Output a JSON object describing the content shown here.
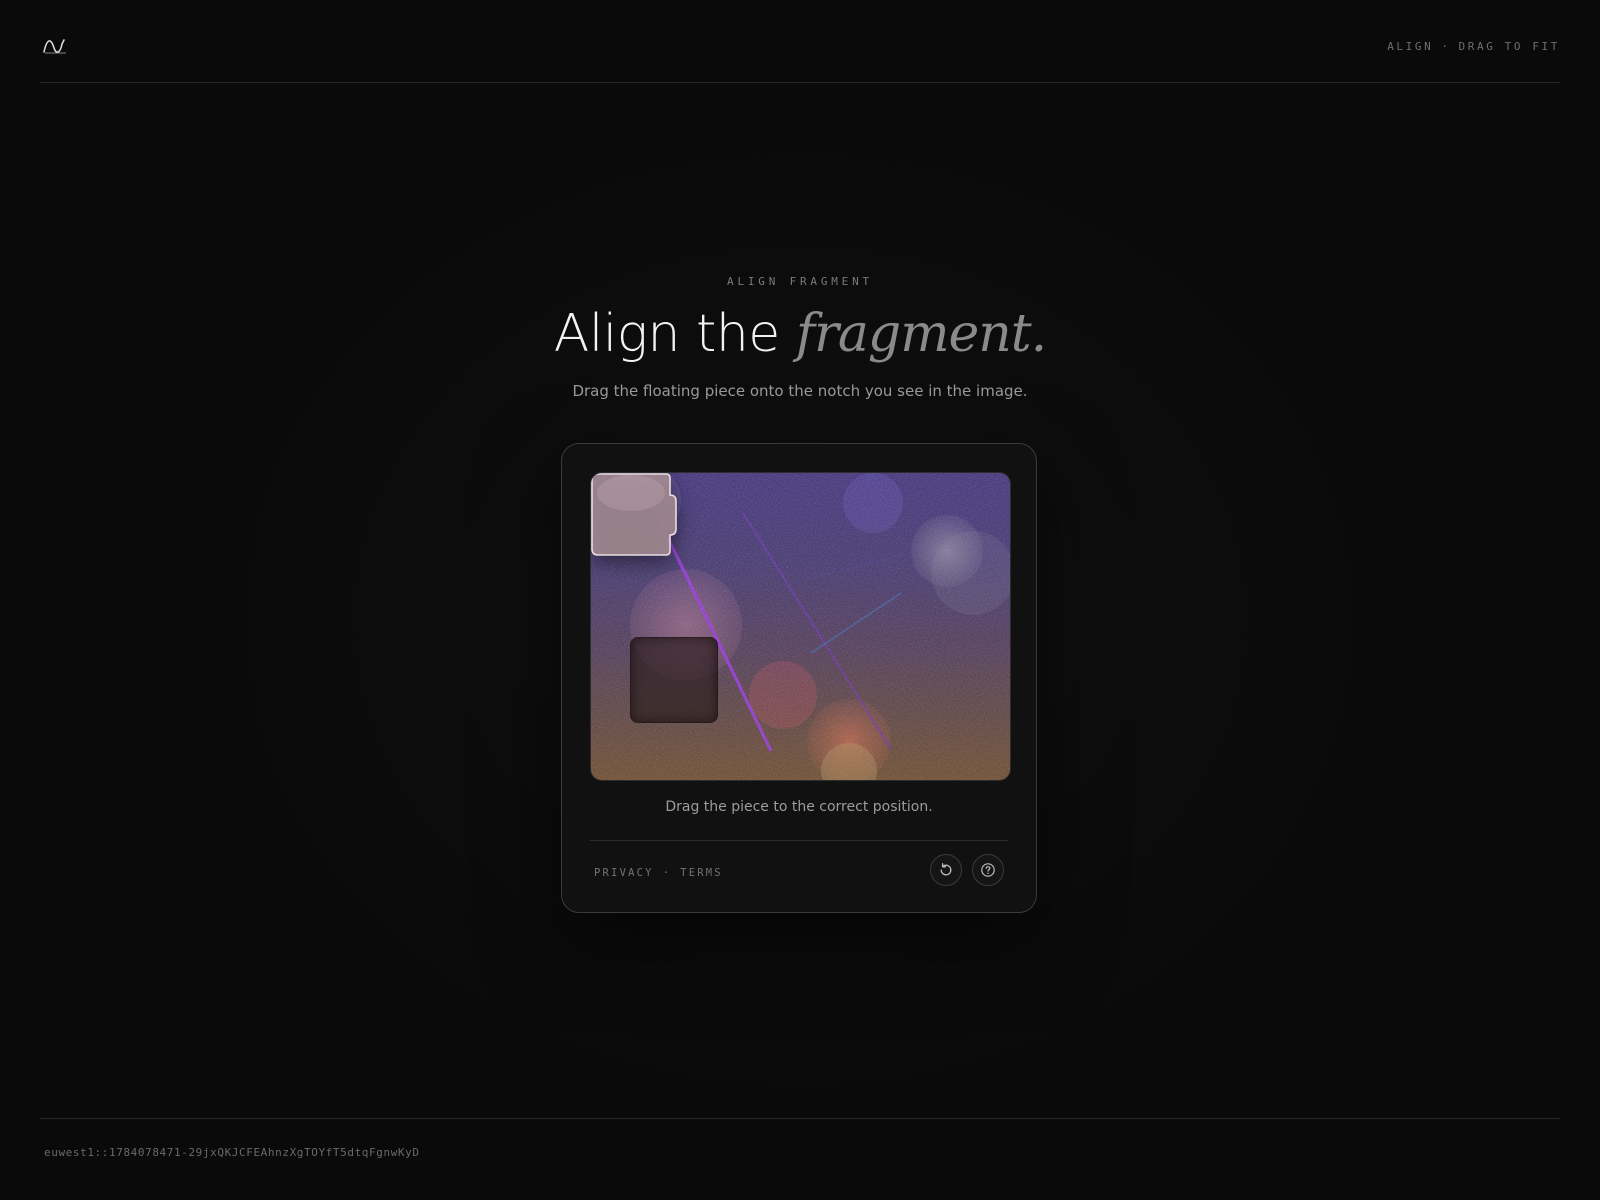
{
  "header": {
    "logo_icon": "wave-logo-icon",
    "tag_left": "ALIGN",
    "tag_sep": "·",
    "tag_right": "DRAG TO FIT"
  },
  "hero": {
    "eyebrow": "ALIGN FRAGMENT",
    "title_plain": "Align the",
    "title_emphasis": "fragment.",
    "subtitle": "Drag the floating piece onto the notch you see in the image."
  },
  "captcha": {
    "instruction": "Drag the piece to the correct position.",
    "privacy_label": "PRIVACY",
    "link_sep": "·",
    "terms_label": "TERMS",
    "refresh_icon": "refresh-icon",
    "help_icon": "help-icon"
  },
  "footer": {
    "session_id": "euwest1::1784078471-29jxQKJCFEAhnzXgTOYfT5dtqFgnwKyD"
  },
  "colors": {
    "background": "#0a0a0a",
    "card": "#111111",
    "accent_purple": "#8a2be2",
    "piece": "#a08c8c"
  }
}
